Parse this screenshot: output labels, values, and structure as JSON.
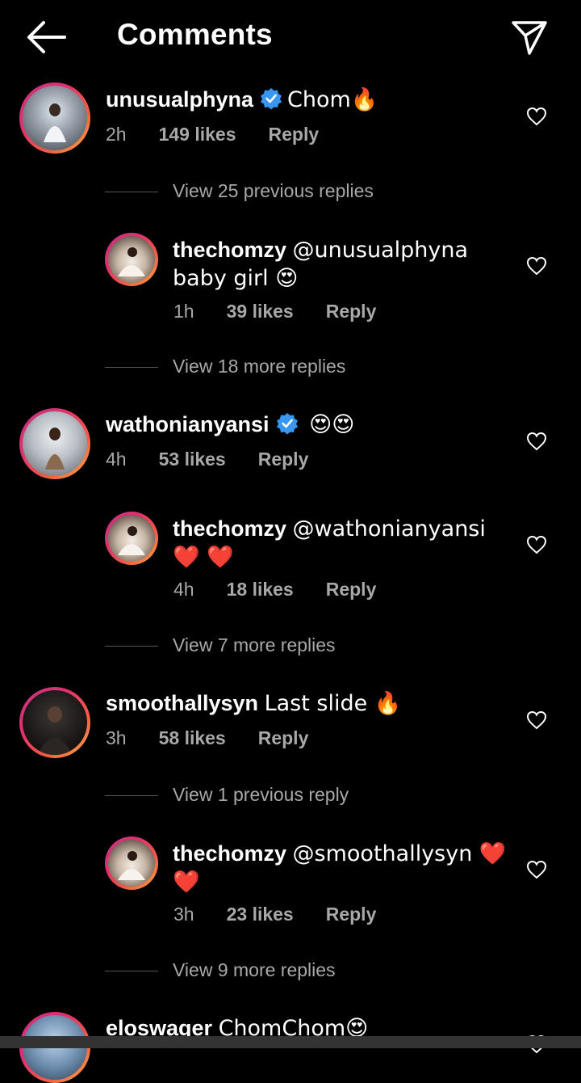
{
  "header": {
    "title": "Comments"
  },
  "comments": [
    {
      "username": "unusualphyna",
      "text": "Chom🔥",
      "time": "2h",
      "likes": "149 likes",
      "reply": "Reply"
    },
    {
      "username": "wathonianyansi",
      "text": "😍😍",
      "time": "4h",
      "likes": "53 likes",
      "reply": "Reply"
    },
    {
      "username": "smoothallysyn",
      "text": "Last slide 🔥",
      "time": "3h",
      "likes": "58 likes",
      "reply": "Reply"
    },
    {
      "username": "eloswager",
      "text": "ChomChom😍"
    }
  ],
  "replies": [
    {
      "username": "thechomzy",
      "text": "@unusualphyna baby girl 😍",
      "time": "1h",
      "likes": "39 likes",
      "reply": "Reply"
    },
    {
      "username": "thechomzy",
      "text": "@wathonianyansi ❤️ ❤️",
      "time": "4h",
      "likes": "18 likes",
      "reply": "Reply"
    },
    {
      "username": "thechomzy",
      "text": "@smoothallysyn ❤️ ❤️",
      "time": "3h",
      "likes": "23 likes",
      "reply": "Reply"
    }
  ],
  "view_links": [
    "View 25 previous replies",
    "View 18 more replies",
    "View 7 more replies",
    "View 1 previous reply",
    "View 9 more replies"
  ],
  "colors": {
    "background": "#000000",
    "muted": "#a8a8a8",
    "verified": "#3897f0",
    "ring_start": "#c13584",
    "ring_end": "#fcaf45"
  },
  "icons": [
    "back-arrow-icon",
    "send-icon",
    "verified-badge-icon",
    "heart-outline-icon"
  ]
}
